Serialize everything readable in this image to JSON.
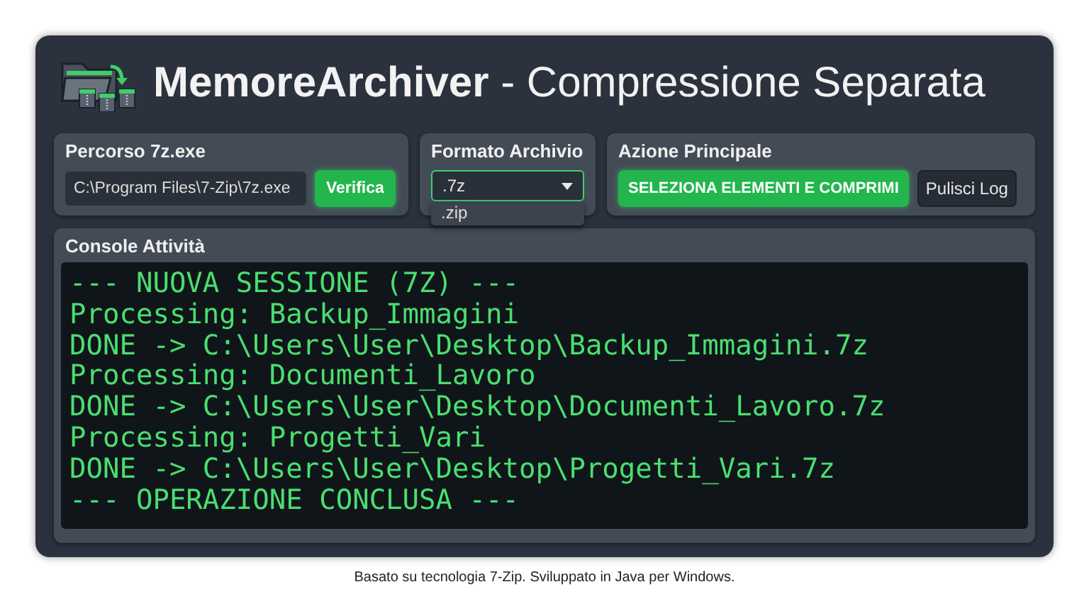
{
  "window": {
    "title": "**MemoreArchiver** - Compressione Separata"
  },
  "path_panel": {
    "label": "Percorso 7z.exe",
    "value": "C:\\Program Files\\7-Zip\\7z.exe",
    "button": "Verifica"
  },
  "format_panel": {
    "label": "Formato Archivio",
    "value": ".7z",
    "expanded": true,
    "options": [
      ".zip"
    ]
  },
  "action_panel": {
    "label": "Azione Principale",
    "buttons": [
      {
        "label": "SELEZIONA ELEMENTI E COMPRIMI",
        "kind": "primary"
      },
      {
        "label": "Pulisci Log",
        "kind": "secondary"
      }
    ]
  },
  "console": {
    "label": "Console Attività",
    "lines": [
      "--- NUOVA SESSIONE (7Z) ---",
      "Processing: Backup_Immagini",
      "DONE -> C:\\Users\\User\\Desktop\\Backup_Immagini.7z",
      "Processing: Documenti_Lavoro",
      "DONE -> C:\\Users\\User\\Desktop\\Documenti_Lavoro.7z",
      "Processing: Progetti_Vari",
      "DONE -> C:\\Users\\User\\Desktop\\Progetti_Vari.7z",
      "--- OPERAZIONE CONCLUSA ---"
    ]
  },
  "footer": "Basato su tecnologia 7-Zip. Sviluppato in Java per Windows."
}
